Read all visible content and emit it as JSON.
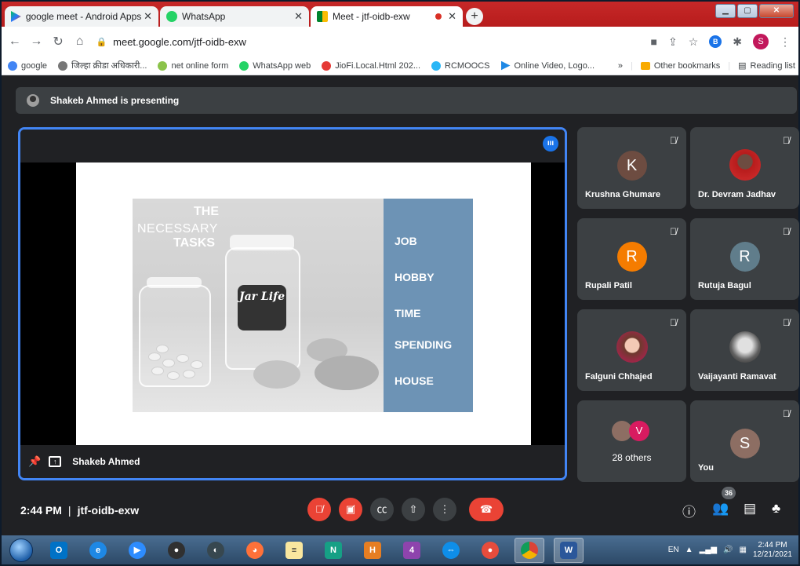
{
  "browser": {
    "tabs": [
      {
        "title": "google meet - Android Apps on ",
        "icon": "play-store-icon"
      },
      {
        "title": "WhatsApp",
        "icon": "whatsapp-icon"
      },
      {
        "title": "Meet - jtf-oidb-exw",
        "icon": "meet-icon",
        "active": true
      }
    ],
    "url": "meet.google.com/jtf-oidb-exw",
    "profile_initial": "S",
    "bookmarks": [
      {
        "label": "google",
        "color": "#4285f4"
      },
      {
        "label": "जिल्हा क्रीडा अधिकारी...",
        "color": "#777777"
      },
      {
        "label": "net online form",
        "color": "#8bc34a"
      },
      {
        "label": "WhatsApp web",
        "color": "#25d366"
      },
      {
        "label": "JioFi.Local.Html 202...",
        "color": "#e53935"
      },
      {
        "label": "RCMOOCS",
        "color": "#29b6f6"
      },
      {
        "label": "Online Video, Logo...",
        "color": "#1e88e5"
      }
    ],
    "bookmarks_more": "»",
    "other_bookmarks": "Other bookmarks",
    "reading_list": "Reading list"
  },
  "meet": {
    "presenting_banner": "Shakeb Ahmed is presenting",
    "presenter_name": "Shakeb Ahmed",
    "slide": {
      "title_the": "THE",
      "title_necessary": "NECESSARY",
      "title_tasks": "TASKS",
      "jar_label": "Jar Life",
      "items": [
        "JOB",
        "HOBBY",
        "TIME",
        "SPENDING",
        "HOUSE"
      ]
    },
    "participants": [
      {
        "name": "Krushna Ghumare",
        "initial": "K",
        "color": "#6d4c41",
        "muted": true
      },
      {
        "name": "Dr. Devram Jadhav",
        "initial": "",
        "color": "#b71c1c",
        "muted": true,
        "photo": true
      },
      {
        "name": "Rupali Patil",
        "initial": "R",
        "color": "#f57c00",
        "muted": true
      },
      {
        "name": "Rutuja Bagul",
        "initial": "R",
        "color": "#607d8b",
        "muted": true
      },
      {
        "name": "Falguni Chhajed",
        "initial": "",
        "color": "#c2185b",
        "muted": true,
        "photo": true
      },
      {
        "name": "Vaijayanti Ramavat",
        "initial": "",
        "color": "#9e9e9e",
        "muted": true,
        "photo": true
      }
    ],
    "others": {
      "label": "28 others",
      "initial": "V"
    },
    "you": {
      "name": "You",
      "initial": "S",
      "color": "#8d6e63"
    },
    "time": "2:44 PM",
    "separator": "|",
    "meeting_code": "jtf-oidb-exw",
    "participant_count": "36"
  },
  "taskbar": {
    "language": "EN",
    "time": "2:44 PM",
    "date": "12/21/2021"
  }
}
